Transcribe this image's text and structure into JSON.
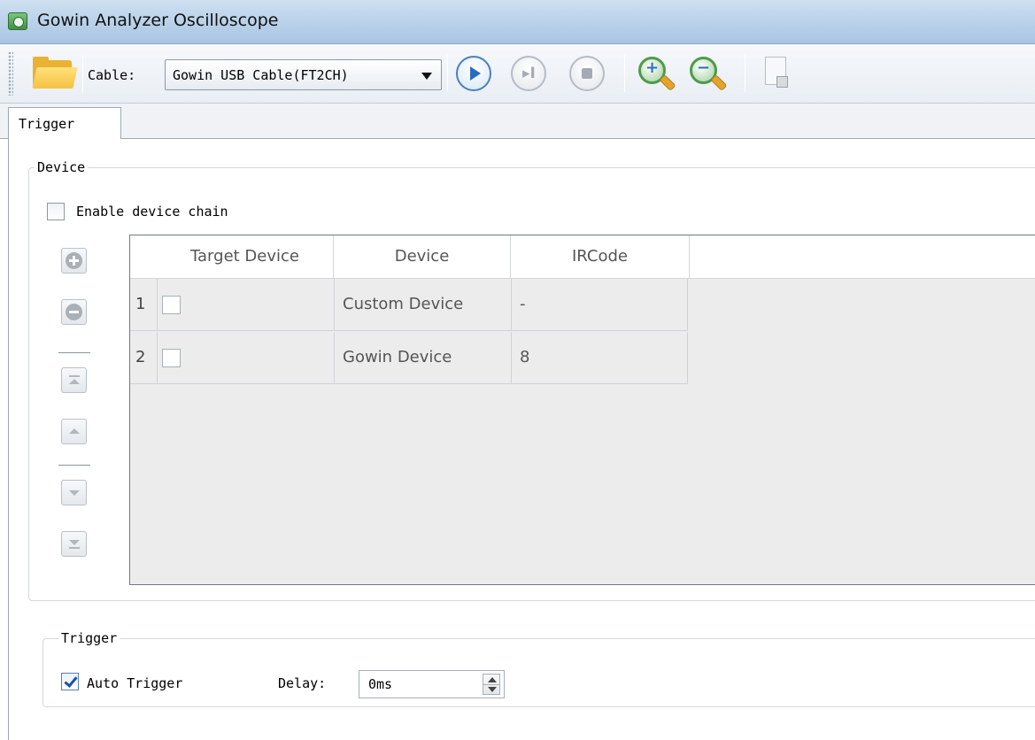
{
  "window": {
    "title": "Gowin Analyzer Oscilloscope",
    "icon": "gowin-app-icon"
  },
  "toolbar": {
    "open_icon": "folder-open-icon",
    "cable_label": "Cable:",
    "cable_value": "Gowin USB Cable(FT2CH)",
    "buttons": [
      "run-icon",
      "step-icon",
      "stop-icon",
      "zoom-in-icon",
      "zoom-out-icon",
      "export-icon"
    ]
  },
  "tabs": [
    {
      "label": "Trigger",
      "active": true
    }
  ],
  "device_group": {
    "title": "Device",
    "enable_chain_label": "Enable device chain",
    "enable_chain_checked": false,
    "table": {
      "columns": [
        "Target Device",
        "Device",
        "IRCode"
      ],
      "rows": [
        {
          "num": "1",
          "target_checked": false,
          "device": "Custom Device",
          "ircode": "-"
        },
        {
          "num": "2",
          "target_checked": false,
          "device": "Gowin Device",
          "ircode": "8"
        }
      ]
    },
    "side_buttons": [
      "add-icon",
      "remove-icon",
      "move-top-icon",
      "move-up-icon",
      "move-down-icon",
      "move-bottom-icon"
    ]
  },
  "trigger_group": {
    "title": "Trigger",
    "auto_trigger_label": "Auto Trigger",
    "auto_trigger_checked": true,
    "delay_label": "Delay:",
    "delay_value": "0ms"
  },
  "colors": {
    "titlebar": "#bcd3ea",
    "accent": "#2a6bc2",
    "table_bg": "#ececec"
  }
}
